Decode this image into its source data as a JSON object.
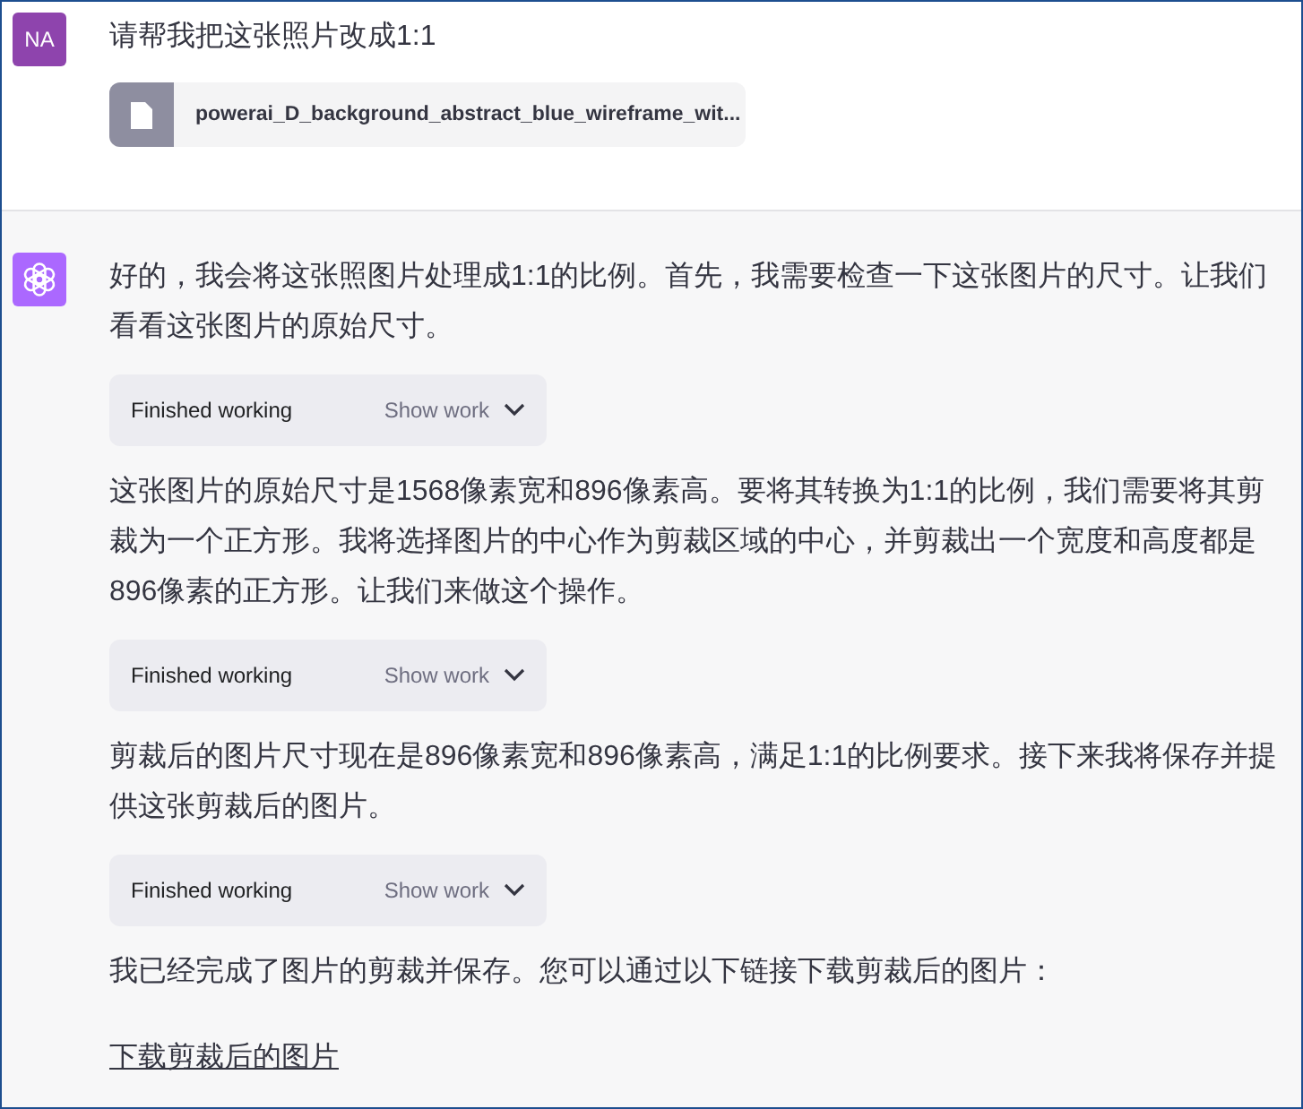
{
  "user_message": {
    "avatar": "NA",
    "text": "请帮我把这张照片改成1:1",
    "attachment": {
      "filename": "powerai_D_background_abstract_blue_wireframe_wit..."
    }
  },
  "assistant_message": {
    "blocks": [
      {
        "kind": "paragraph",
        "text": "好的，我会将这张照图片处理成1:1的比例。首先，我需要检查一下这张图片的尺寸。让我们看看这张图片的原始尺寸。"
      },
      {
        "kind": "tool",
        "status": "Finished working",
        "toggle": "Show work",
        "expanded": false
      },
      {
        "kind": "paragraph",
        "text": "这张图片的原始尺寸是1568像素宽和896像素高。要将其转换为1:1的比例，我们需要将其剪裁为一个正方形。我将选择图片的中心作为剪裁区域的中心，并剪裁出一个宽度和高度都是896像素的正方形。让我们来做这个操作。"
      },
      {
        "kind": "tool",
        "status": "Finished working",
        "toggle": "Show work",
        "expanded": false
      },
      {
        "kind": "paragraph",
        "text": "剪裁后的图片尺寸现在是896像素宽和896像素高，满足1:1的比例要求。接下来我将保存并提供这张剪裁后的图片。"
      },
      {
        "kind": "tool",
        "status": "Finished working",
        "toggle": "Show work",
        "expanded": false
      },
      {
        "kind": "paragraph",
        "text": "我已经完成了图片的剪裁并保存。您可以通过以下链接下载剪裁后的图片："
      },
      {
        "kind": "link",
        "text": "下载剪裁后的图片"
      }
    ]
  }
}
